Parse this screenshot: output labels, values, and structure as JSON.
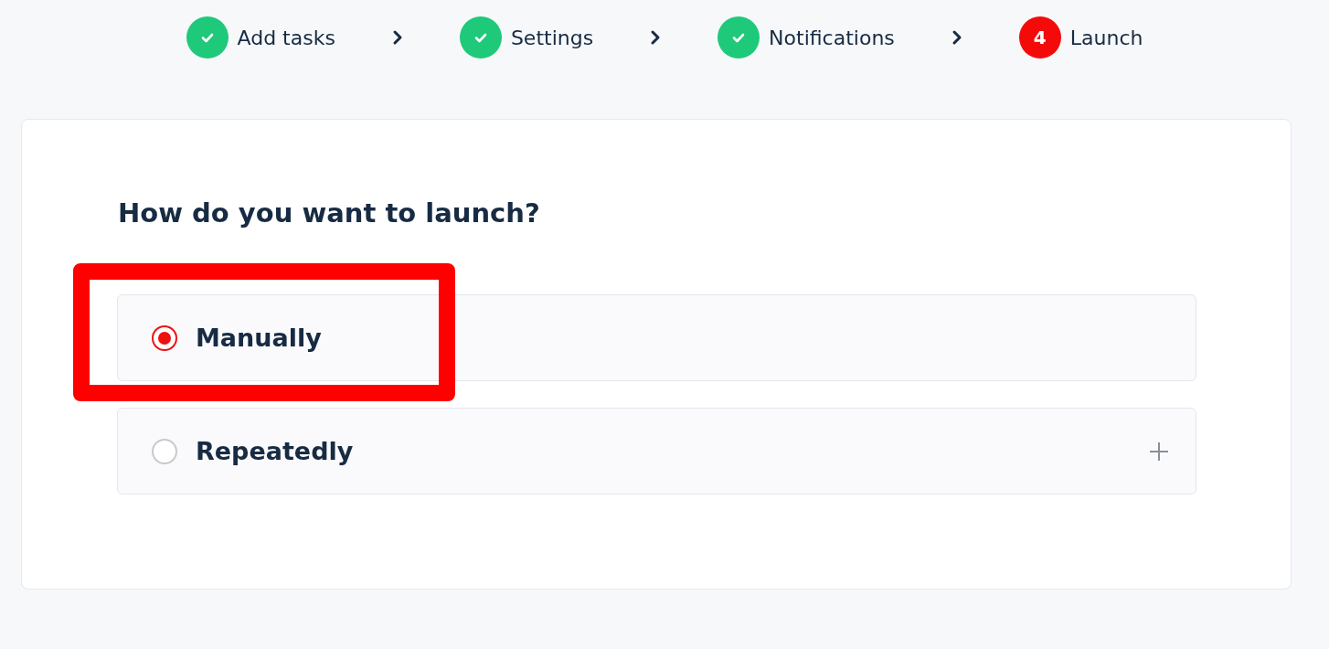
{
  "steps": [
    {
      "label": "Add tasks",
      "kind": "done"
    },
    {
      "label": "Settings",
      "kind": "done"
    },
    {
      "label": "Notifications",
      "kind": "done"
    },
    {
      "label": "Launch",
      "kind": "current",
      "number": "4"
    }
  ],
  "card": {
    "heading": "How do you want to launch?",
    "options": [
      {
        "label": "Manually",
        "selected": true,
        "expandable": false,
        "highlighted": true
      },
      {
        "label": "Repeatedly",
        "selected": false,
        "expandable": true,
        "highlighted": false
      }
    ]
  }
}
